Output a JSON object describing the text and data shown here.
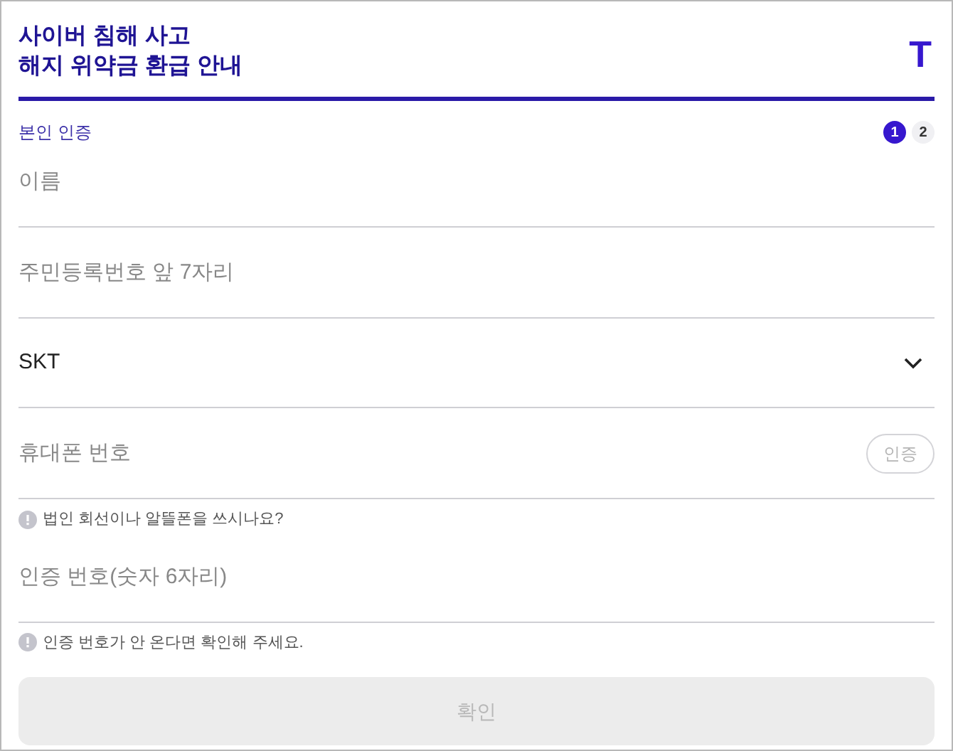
{
  "header": {
    "title_lines": [
      "사이버 침해 사고",
      "해지 위약금 환급 안내"
    ],
    "logo": "T"
  },
  "section": {
    "title": "본인 인증",
    "steps": [
      {
        "label": "1",
        "selected": true
      },
      {
        "label": "2",
        "selected": false
      }
    ]
  },
  "fields": [
    {
      "kind": "input",
      "placeholder": "이름"
    },
    {
      "kind": "input",
      "placeholder": "주민등록번호 앞 7자리"
    },
    {
      "kind": "select",
      "value": "SKT"
    },
    {
      "kind": "input",
      "placeholder": "휴대폰 번호",
      "button": {
        "label": "인증",
        "disabled": true
      },
      "hint": "법인 회선이나 알뜰폰을 쓰시나요?"
    },
    {
      "kind": "input",
      "placeholder": "인증 번호(숫자 6자리)",
      "hint": "인증 번호가 안 온다면 확인해 주세요."
    }
  ],
  "submit": {
    "label": "확인",
    "disabled": true
  }
}
